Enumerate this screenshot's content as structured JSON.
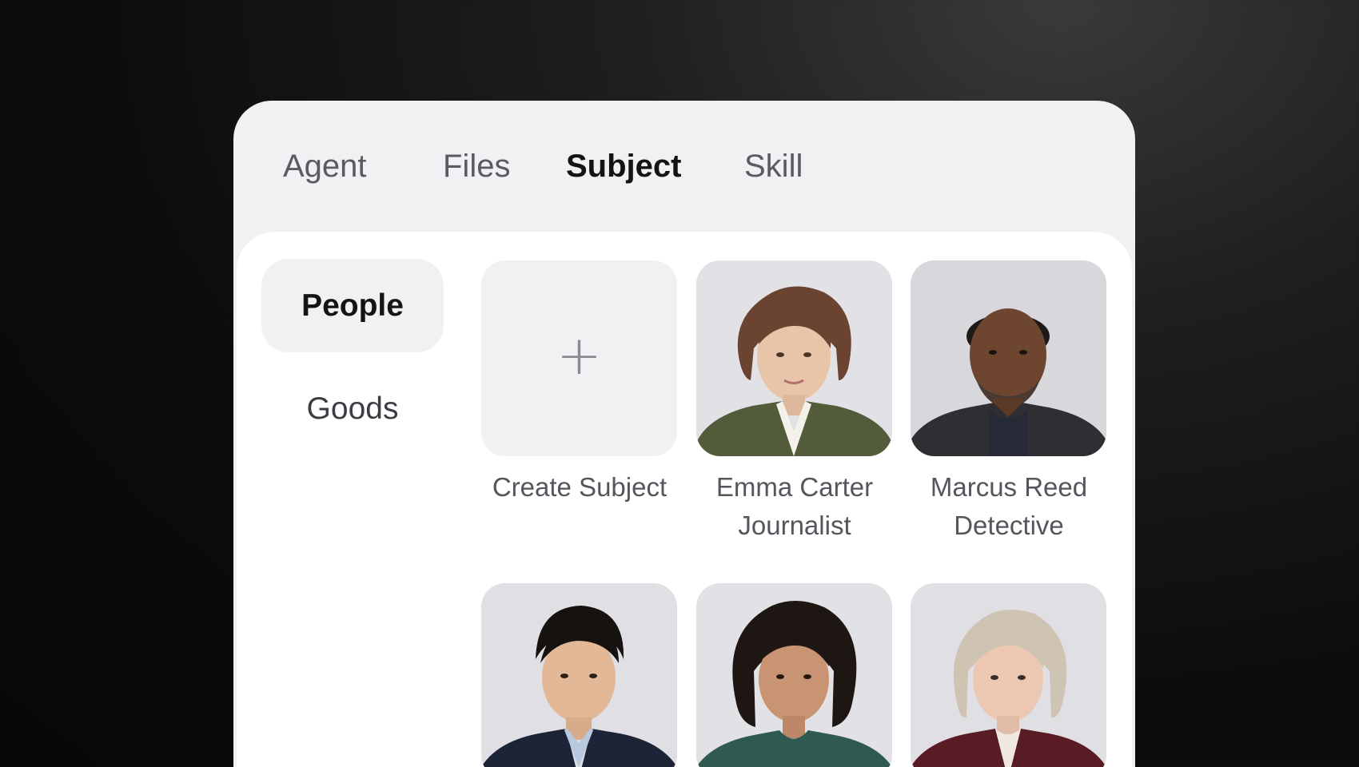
{
  "tabs": [
    {
      "label": "Agent",
      "active": false
    },
    {
      "label": "Files",
      "active": false
    },
    {
      "label": "Subject",
      "active": true
    },
    {
      "label": "Skill",
      "active": false
    }
  ],
  "categories": [
    {
      "label": "People",
      "active": true
    },
    {
      "label": "Goods",
      "active": false
    }
  ],
  "create_card": {
    "label": "Create Subject",
    "icon": "plus-icon"
  },
  "subjects": [
    {
      "name": "Emma Carter",
      "role": "Journalist"
    },
    {
      "name": "Marcus Reed",
      "role": "Detective"
    },
    {
      "name": "",
      "role": ""
    },
    {
      "name": "",
      "role": ""
    },
    {
      "name": "",
      "role": ""
    }
  ],
  "colors": {
    "panel_bg": "#f1f1f3",
    "content_bg": "#ffffff",
    "active_text": "#141414",
    "muted_text": "#55555d"
  }
}
